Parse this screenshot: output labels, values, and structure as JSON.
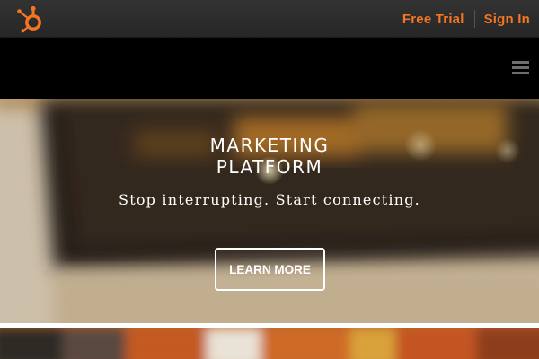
{
  "header": {
    "logo_icon": "hubspot-sprocket-icon",
    "free_trial_label": "Free Trial",
    "sign_in_label": "Sign In",
    "link_color": "#f47622"
  },
  "navbar": {
    "menu_icon": "hamburger-menu-icon"
  },
  "hero": {
    "title_line1": "MARKETING",
    "title_line2": "PLATFORM",
    "tagline": "Stop interrupting. Start connecting.",
    "cta_label": "LEARN MORE"
  },
  "colors": {
    "accent": "#f47622",
    "topbar": "#2e2e2e",
    "navbar": "#000000"
  }
}
